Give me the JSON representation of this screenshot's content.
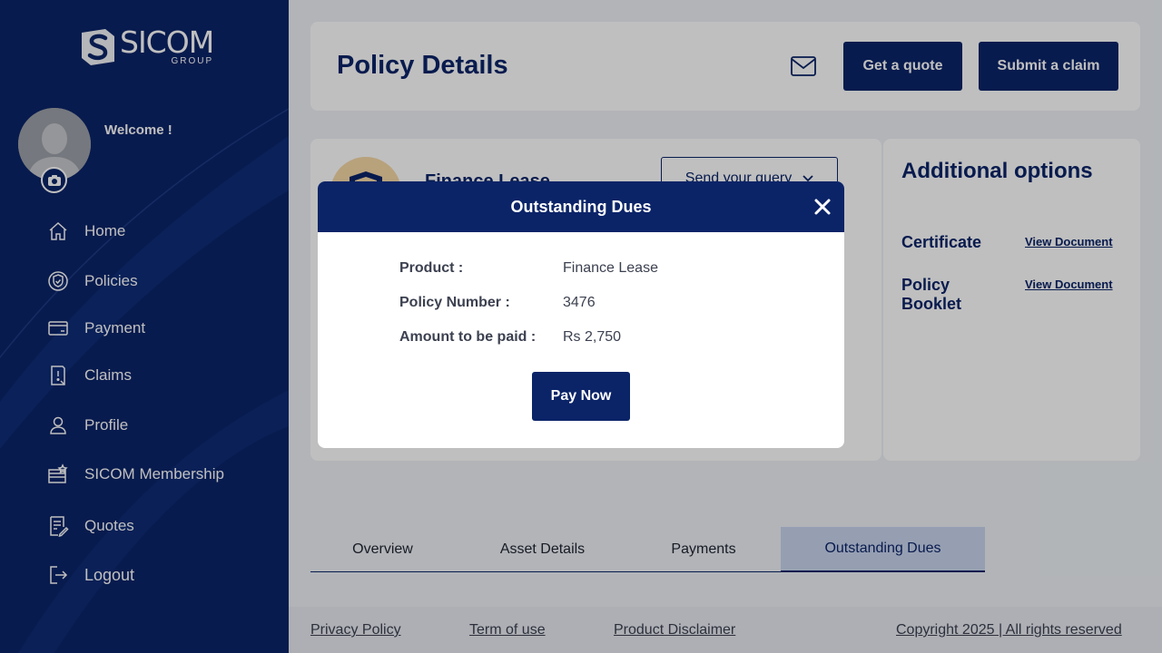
{
  "brand": {
    "name": "SICOM",
    "subtitle": "GROUP",
    "primary_color": "#0b2468",
    "accent_color": "#f6d8a6"
  },
  "user": {
    "welcome": "Welcome !"
  },
  "sidebar": {
    "items": [
      {
        "label": "Home",
        "icon": "home-icon"
      },
      {
        "label": "Policies",
        "icon": "shield-check-icon"
      },
      {
        "label": "Payment",
        "icon": "card-icon"
      },
      {
        "label": "Claims",
        "icon": "claim-alert-icon"
      },
      {
        "label": "Profile",
        "icon": "user-icon"
      },
      {
        "label": "SICOM Membership",
        "icon": "membership-icon"
      },
      {
        "label": "Quotes",
        "icon": "quote-doc-icon"
      },
      {
        "label": "Logout",
        "icon": "logout-icon"
      }
    ]
  },
  "header": {
    "title": "Policy Details",
    "quote_label": "Get a quote",
    "claim_label": "Submit a claim"
  },
  "policy_card": {
    "product_name": "Finance Lease",
    "query_label": "Send your query"
  },
  "additional_options": {
    "title": "Additional options",
    "items": [
      {
        "label": "Certificate",
        "link": "View Document"
      },
      {
        "label": "Policy Booklet",
        "link": "View Document"
      }
    ]
  },
  "tabs": [
    {
      "label": "Overview",
      "active": false
    },
    {
      "label": "Asset Details",
      "active": false
    },
    {
      "label": "Payments",
      "active": false
    },
    {
      "label": "Outstanding Dues",
      "active": true
    }
  ],
  "footer": {
    "privacy": "Privacy Policy",
    "terms": "Term of use",
    "disclaimer": "Product Disclaimer",
    "copyright": "Copyright 2025 | All rights reserved"
  },
  "modal": {
    "title": "Outstanding Dues",
    "rows": [
      {
        "key": "Product :",
        "value": "Finance Lease"
      },
      {
        "key": "Policy Number :",
        "value": "3476"
      },
      {
        "key": "Amount to be paid :",
        "value": "Rs 2,750"
      }
    ],
    "pay_label": "Pay Now"
  }
}
